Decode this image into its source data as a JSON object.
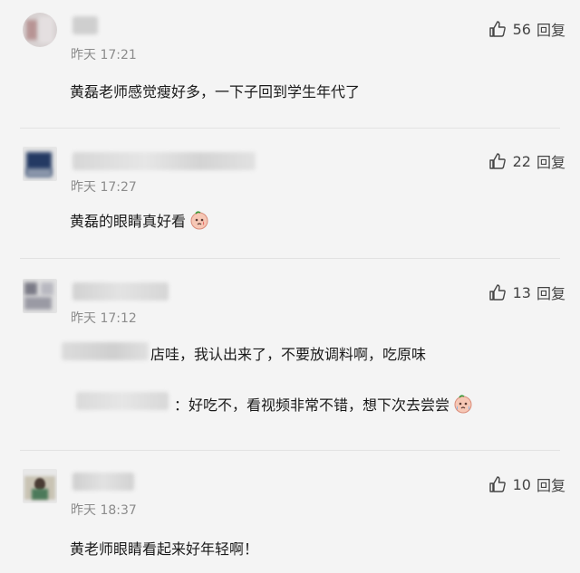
{
  "comments": [
    {
      "time": "昨天 17:21",
      "likes": "56",
      "reply_label": "回复",
      "text": "黄磊老师感觉瘦好多，一下子回到学生年代了"
    },
    {
      "time": "昨天 17:27",
      "likes": "22",
      "reply_label": "回复",
      "text": "黄磊的眼睛真好看"
    },
    {
      "time": "昨天 17:12",
      "likes": "13",
      "reply_label": "回复",
      "text": "店哇，我认出来了，不要放调料啊，吃原味",
      "reply": {
        "text": "：好吃不，看视频非常不错，想下次去尝尝"
      }
    },
    {
      "time": "昨天 18:37",
      "likes": "10",
      "reply_label": "回复",
      "text": "黄老师眼睛看起来好年轻啊！"
    }
  ],
  "colors": {
    "background": "#f4f4f4",
    "divider": "#e2e2e2",
    "meta_text": "#8c8c8c",
    "body_text": "#1a1a1a"
  },
  "icons": {
    "like": "thumbs-up-icon",
    "emoji": "crying-face-emoji-icon"
  }
}
